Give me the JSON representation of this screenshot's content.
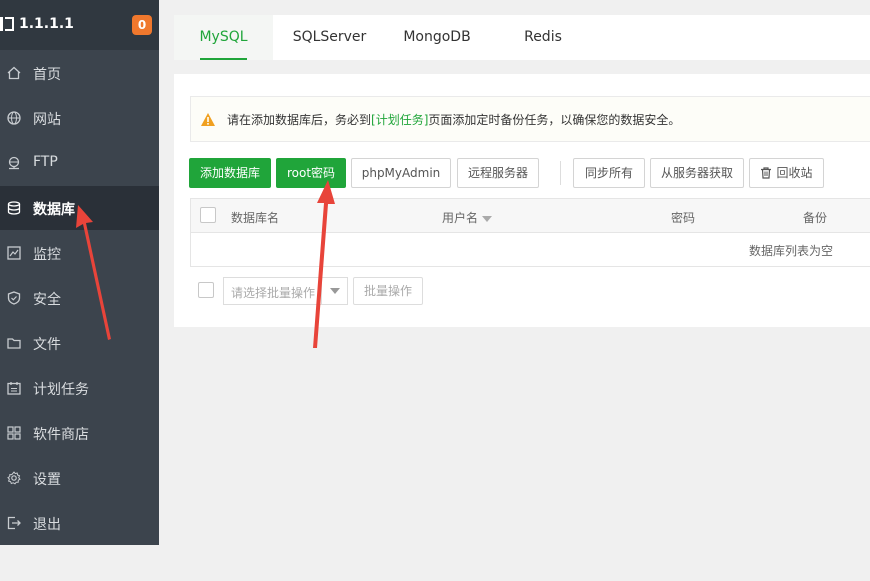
{
  "header": {
    "ip": "1.1.1.1",
    "badge": "0"
  },
  "sidebar": {
    "items": [
      {
        "label": "首页",
        "icon": "home-icon"
      },
      {
        "label": "网站",
        "icon": "globe-icon"
      },
      {
        "label": "FTP",
        "icon": "ftp-icon"
      },
      {
        "label": "数据库",
        "icon": "database-icon",
        "active": true
      },
      {
        "label": "监控",
        "icon": "monitor-icon"
      },
      {
        "label": "安全",
        "icon": "shield-icon"
      },
      {
        "label": "文件",
        "icon": "folder-icon"
      },
      {
        "label": "计划任务",
        "icon": "calendar-icon"
      },
      {
        "label": "软件商店",
        "icon": "grid-icon"
      },
      {
        "label": "设置",
        "icon": "gear-icon"
      },
      {
        "label": "退出",
        "icon": "logout-icon"
      }
    ]
  },
  "tabs": [
    {
      "label": "MySQL",
      "active": true
    },
    {
      "label": "SQLServer"
    },
    {
      "label": "MongoDB"
    },
    {
      "label": "Redis"
    }
  ],
  "notice": {
    "before": "请在添加数据库后，务必到",
    "link": "[计划任务]",
    "after": "页面添加定时备份任务，以确保您的数据安全。"
  },
  "toolbar": {
    "add_db": "添加数据库",
    "root_password": "root密码",
    "phpmyadmin": "phpMyAdmin",
    "remote_server": "远程服务器",
    "sync_all": "同步所有",
    "fetch_from_server": "从服务器获取",
    "recycle_bin": "回收站"
  },
  "table": {
    "columns": [
      "数据库名",
      "用户名",
      "密码",
      "备份"
    ],
    "empty_text": "数据库列表为空"
  },
  "batch": {
    "select_placeholder": "请选择批量操作",
    "button": "批量操作"
  },
  "colors": {
    "accent": "#20a53a",
    "sidebar_bg": "#3c444d",
    "badge": "#f0782d",
    "annotation": "#e8443a"
  }
}
